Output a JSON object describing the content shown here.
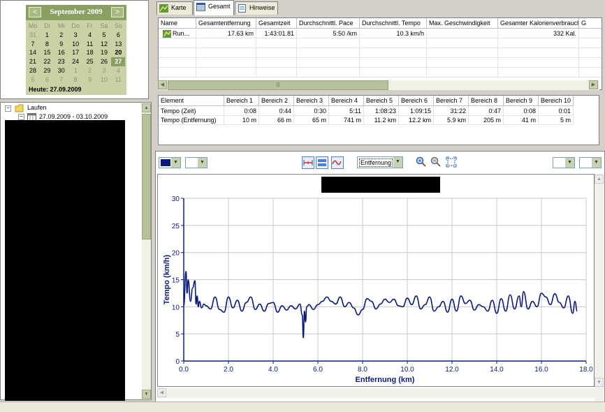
{
  "calendar": {
    "month_title": "September 2009",
    "prev": "<",
    "next": ">",
    "weekdays": [
      "Mo",
      "Di",
      "Mi",
      "Do",
      "Fr",
      "Sa",
      "So"
    ],
    "weeks": [
      [
        "31",
        "1",
        "2",
        "3",
        "4",
        "5",
        "6"
      ],
      [
        "7",
        "8",
        "9",
        "10",
        "11",
        "12",
        "13"
      ],
      [
        "14",
        "15",
        "16",
        "17",
        "18",
        "19",
        "20"
      ],
      [
        "21",
        "22",
        "23",
        "24",
        "25",
        "26",
        "27"
      ],
      [
        "28",
        "29",
        "30",
        "1",
        "2",
        "3",
        "4"
      ],
      [
        "5",
        "6",
        "7",
        "8",
        "9",
        "10",
        "11"
      ]
    ],
    "today_label": "Heute: 27.09.2009",
    "selected_day": "27"
  },
  "tree": {
    "root_label": "Laufen",
    "child_label": "27.09.2009 - 03.10.2009"
  },
  "tabs": [
    {
      "label": "Karte"
    },
    {
      "label": "Gesamt"
    },
    {
      "label": "Hinweise"
    }
  ],
  "summary": {
    "columns": [
      "Name",
      "Gesamtentfernung",
      "Gesamtzeit",
      "Durchschnittl. Pace",
      "Durchschnittl. Tempo",
      "Max. Geschwindigkeit",
      "Gesamter Kalorienverbrauch",
      "G"
    ],
    "rows": [
      [
        "Run...",
        "17.63 km",
        "1:43:01.81",
        "5:50 /km",
        "10.3 km/h",
        "",
        "332 Kal.",
        ""
      ]
    ],
    "scroll_mark": "|||"
  },
  "zones": {
    "columns": [
      "Element",
      "Bereich 1",
      "Bereich 2",
      "Bereich 3",
      "Bereich 4",
      "Bereich 5",
      "Bereich 6",
      "Bereich 7",
      "Bereich 8",
      "Bereich 9",
      "Bereich 10"
    ],
    "rows": [
      [
        "Tempo (Zeit)",
        "0:08",
        "0:44",
        "0:30",
        "5:11",
        "1:08:23",
        "1:09:15",
        "31:22",
        "0:47",
        "0:08",
        "0:01"
      ],
      [
        "Tempo (Entfernung)",
        "10 m",
        "66 m",
        "65 m",
        "741 m",
        "11.2 km",
        "12.2 km",
        "5.9 km",
        "205 m",
        "41 m",
        "5 m"
      ]
    ]
  },
  "toolbar": {
    "x_axis_select": "Entfernung",
    "line_color": "#0a1a7a"
  },
  "chart_data": {
    "type": "line",
    "title": "",
    "xlabel": "Entfernung (km)",
    "ylabel": "Tempo (km/h)",
    "xlim": [
      0,
      18
    ],
    "ylim": [
      0,
      30
    ],
    "xticks": [
      "0.0",
      "2.0",
      "4.0",
      "6.0",
      "8.0",
      "10.0",
      "12.0",
      "14.0",
      "16.0",
      "18.0"
    ],
    "yticks": [
      "0",
      "5",
      "10",
      "15",
      "20",
      "25",
      "30"
    ],
    "grid": true,
    "series": [
      {
        "x": [
          0.0,
          0.1,
          0.15,
          0.2,
          0.3,
          0.4,
          0.5,
          0.55,
          0.6,
          0.65,
          0.7,
          0.8,
          0.9,
          1.0,
          1.2,
          1.4,
          1.6,
          1.8,
          2.0,
          2.2,
          2.4,
          2.6,
          2.8,
          3.0,
          3.2,
          3.4,
          3.6,
          3.8,
          4.0,
          4.2,
          4.4,
          4.6,
          4.8,
          5.0,
          5.2,
          5.3,
          5.35,
          5.4,
          5.45,
          5.5,
          5.6,
          5.8,
          6.0,
          6.2,
          6.4,
          6.6,
          6.8,
          7.0,
          7.2,
          7.4,
          7.6,
          7.8,
          8.0,
          8.2,
          8.4,
          8.6,
          8.8,
          9.0,
          9.2,
          9.4,
          9.6,
          9.8,
          10.0,
          10.2,
          10.4,
          10.6,
          10.8,
          11.0,
          11.2,
          11.4,
          11.6,
          11.8,
          12.0,
          12.2,
          12.4,
          12.6,
          12.8,
          13.0,
          13.2,
          13.4,
          13.6,
          13.8,
          14.0,
          14.2,
          14.4,
          14.6,
          14.8,
          15.0,
          15.1,
          15.2,
          15.4,
          15.6,
          15.8,
          16.0,
          16.2,
          16.4,
          16.6,
          16.8,
          17.0,
          17.2,
          17.4,
          17.5,
          17.6
        ],
        "y": [
          10.2,
          16.5,
          12.5,
          15.0,
          11.0,
          13.5,
          14.8,
          10.5,
          12.0,
          10.0,
          11.0,
          9.8,
          10.5,
          10.2,
          9.6,
          11.8,
          9.5,
          9.0,
          11.8,
          9.8,
          11.2,
          9.2,
          10.8,
          11.8,
          9.5,
          10.5,
          9.2,
          10.6,
          10.8,
          9.0,
          10.2,
          9.4,
          10.2,
          9.6,
          10.5,
          8.5,
          4.3,
          9.2,
          7.2,
          10.0,
          10.4,
          9.5,
          10.4,
          11.0,
          11.8,
          11.0,
          10.5,
          11.8,
          10.0,
          10.8,
          9.8,
          8.5,
          9.5,
          11.5,
          11.0,
          9.6,
          10.5,
          11.4,
          10.8,
          11.4,
          10.2,
          10.0,
          11.6,
          10.4,
          12.0,
          9.6,
          10.4,
          11.8,
          9.2,
          10.0,
          11.0,
          9.0,
          11.4,
          9.2,
          12.0,
          10.6,
          11.2,
          9.4,
          10.4,
          10.0,
          9.2,
          11.2,
          8.8,
          11.5,
          9.2,
          12.2,
          9.6,
          12.0,
          10.0,
          12.8,
          9.6,
          11.0,
          10.0,
          12.5,
          11.8,
          10.4,
          12.4,
          10.8,
          9.8,
          12.0,
          8.8,
          11.0,
          9.2
        ]
      }
    ]
  }
}
